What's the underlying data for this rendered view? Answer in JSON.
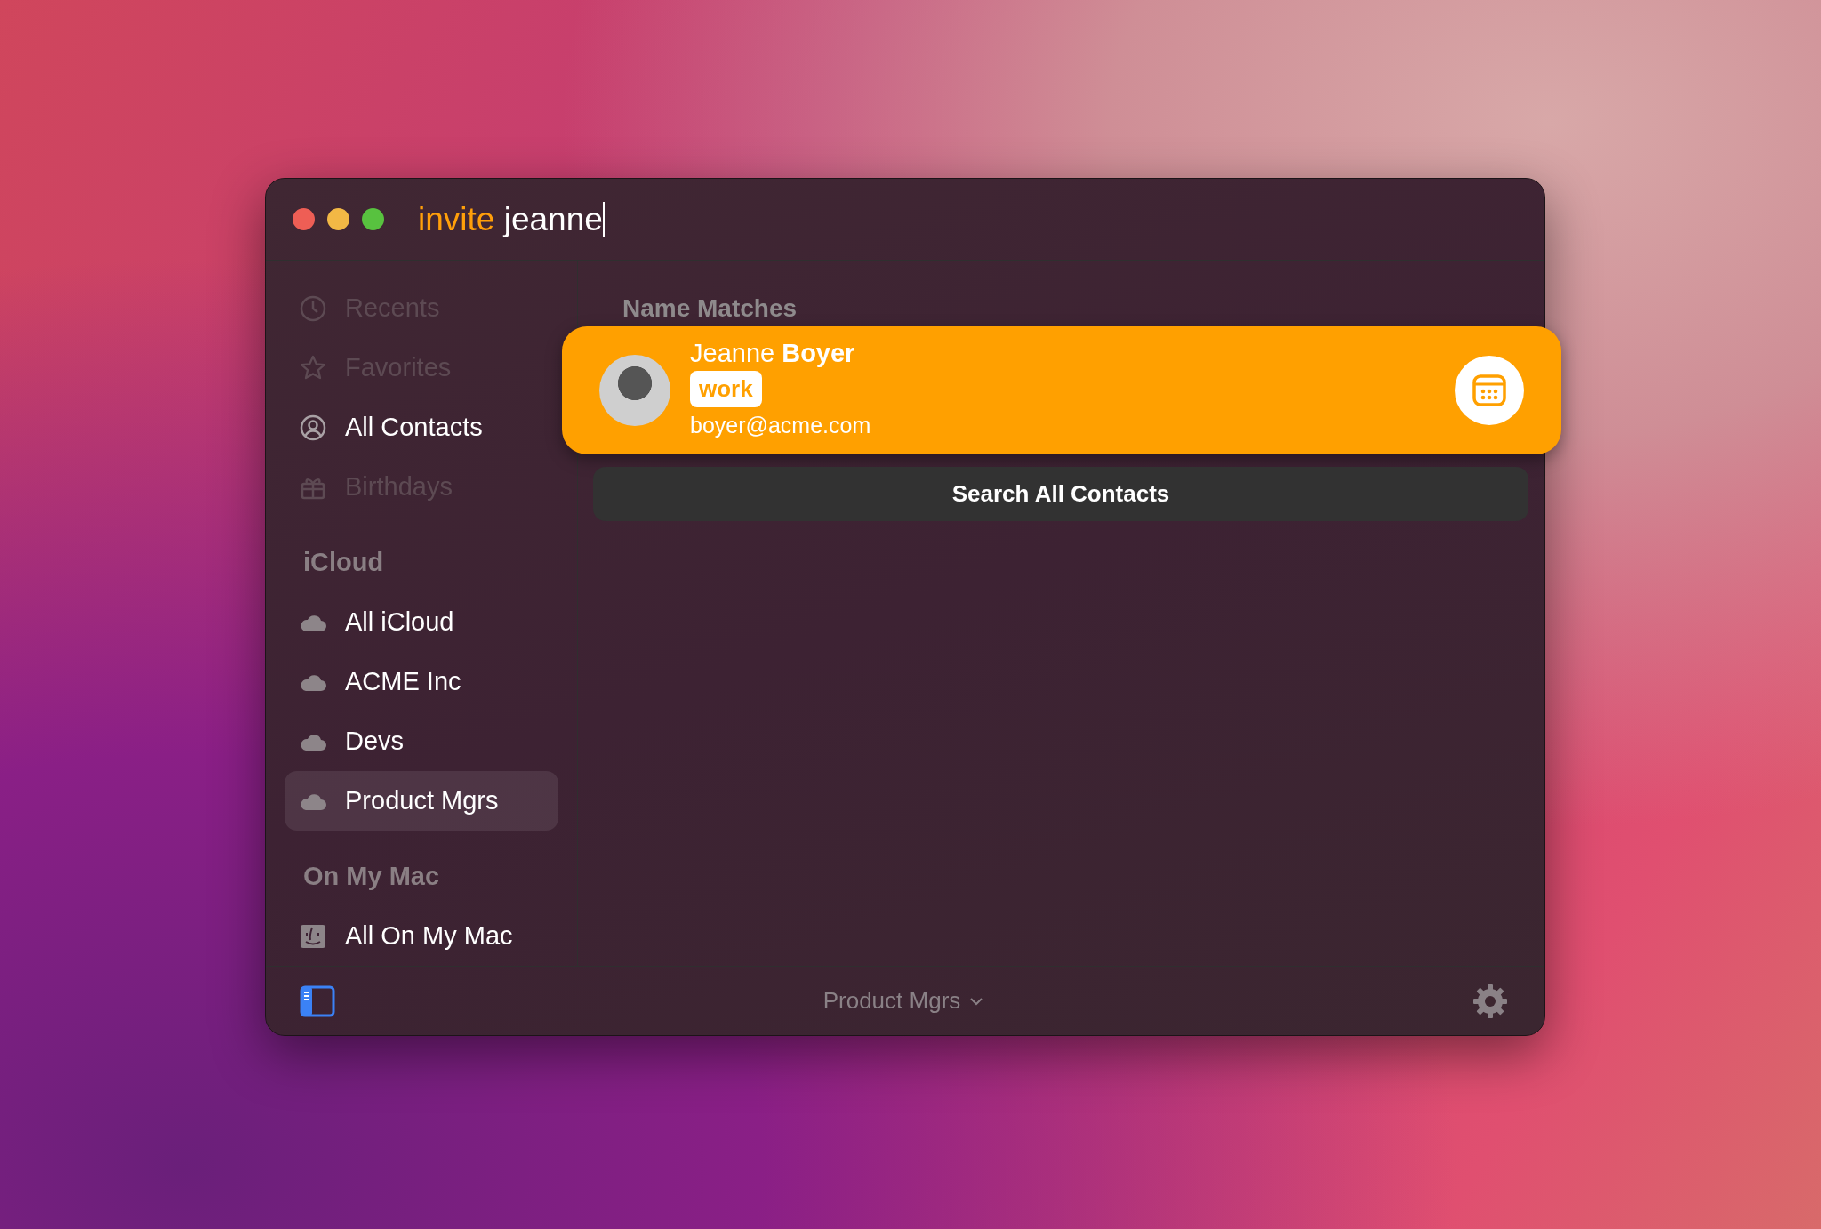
{
  "search": {
    "command": "invite",
    "query": "jeanne"
  },
  "sidebar": {
    "items": [
      {
        "label": "Recents",
        "kind": "clock",
        "disabled": true,
        "selected": false
      },
      {
        "label": "Favorites",
        "kind": "star",
        "disabled": true,
        "selected": false
      },
      {
        "label": "All Contacts",
        "kind": "person",
        "disabled": false,
        "selected": false
      },
      {
        "label": "Birthdays",
        "kind": "gift",
        "disabled": true,
        "selected": false
      }
    ],
    "groups": [
      {
        "title": "iCloud",
        "items": [
          {
            "label": "All iCloud",
            "kind": "cloud",
            "disabled": false,
            "selected": false
          },
          {
            "label": "ACME Inc",
            "kind": "cloud",
            "disabled": false,
            "selected": false
          },
          {
            "label": "Devs",
            "kind": "cloud",
            "disabled": false,
            "selected": false
          },
          {
            "label": "Product Mgrs",
            "kind": "cloud",
            "disabled": false,
            "selected": true
          }
        ]
      },
      {
        "title": "On My Mac",
        "items": [
          {
            "label": "All On My Mac",
            "kind": "finder",
            "disabled": false,
            "selected": false
          }
        ]
      }
    ]
  },
  "results": {
    "heading": "Name Matches",
    "contacts": [
      {
        "name": "Jeanne **Boyer**",
        "tag": "work",
        "email": "boyer@acme.com",
        "selected": true
      }
    ],
    "search_all_button": "Search All Contacts"
  },
  "footer": {
    "group_menu": "Product Mgrs"
  }
}
